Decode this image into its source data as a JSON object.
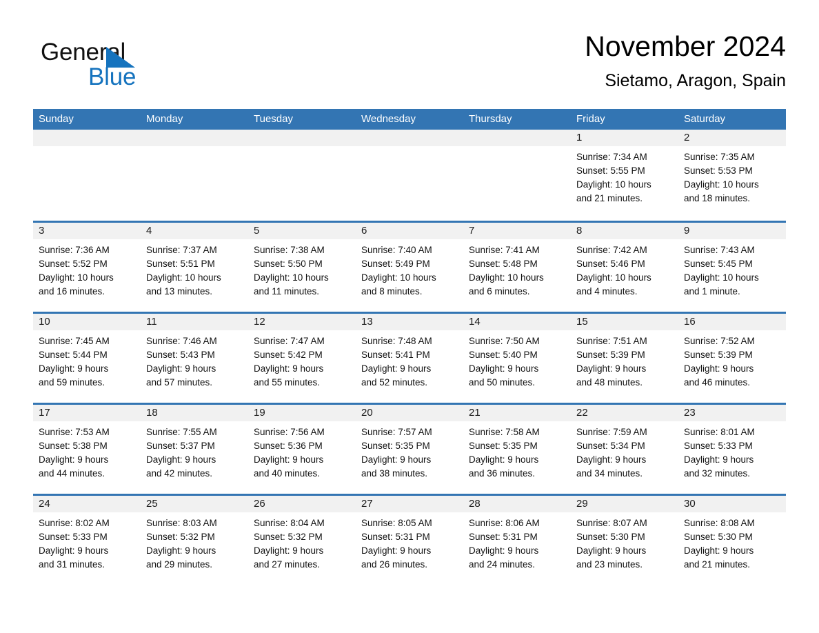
{
  "brand": {
    "name_part1": "General",
    "name_part2": "Blue",
    "accent_color": "#1573be"
  },
  "header": {
    "month_title": "November 2024",
    "location": "Sietamo, Aragon, Spain"
  },
  "calendar": {
    "header_color": "#3375b3",
    "weekdays": [
      "Sunday",
      "Monday",
      "Tuesday",
      "Wednesday",
      "Thursday",
      "Friday",
      "Saturday"
    ],
    "weeks": [
      [
        {
          "day": "",
          "sunrise": "",
          "sunset": "",
          "daylight_line1": "",
          "daylight_line2": ""
        },
        {
          "day": "",
          "sunrise": "",
          "sunset": "",
          "daylight_line1": "",
          "daylight_line2": ""
        },
        {
          "day": "",
          "sunrise": "",
          "sunset": "",
          "daylight_line1": "",
          "daylight_line2": ""
        },
        {
          "day": "",
          "sunrise": "",
          "sunset": "",
          "daylight_line1": "",
          "daylight_line2": ""
        },
        {
          "day": "",
          "sunrise": "",
          "sunset": "",
          "daylight_line1": "",
          "daylight_line2": ""
        },
        {
          "day": "1",
          "sunrise": "Sunrise: 7:34 AM",
          "sunset": "Sunset: 5:55 PM",
          "daylight_line1": "Daylight: 10 hours",
          "daylight_line2": "and 21 minutes."
        },
        {
          "day": "2",
          "sunrise": "Sunrise: 7:35 AM",
          "sunset": "Sunset: 5:53 PM",
          "daylight_line1": "Daylight: 10 hours",
          "daylight_line2": "and 18 minutes."
        }
      ],
      [
        {
          "day": "3",
          "sunrise": "Sunrise: 7:36 AM",
          "sunset": "Sunset: 5:52 PM",
          "daylight_line1": "Daylight: 10 hours",
          "daylight_line2": "and 16 minutes."
        },
        {
          "day": "4",
          "sunrise": "Sunrise: 7:37 AM",
          "sunset": "Sunset: 5:51 PM",
          "daylight_line1": "Daylight: 10 hours",
          "daylight_line2": "and 13 minutes."
        },
        {
          "day": "5",
          "sunrise": "Sunrise: 7:38 AM",
          "sunset": "Sunset: 5:50 PM",
          "daylight_line1": "Daylight: 10 hours",
          "daylight_line2": "and 11 minutes."
        },
        {
          "day": "6",
          "sunrise": "Sunrise: 7:40 AM",
          "sunset": "Sunset: 5:49 PM",
          "daylight_line1": "Daylight: 10 hours",
          "daylight_line2": "and 8 minutes."
        },
        {
          "day": "7",
          "sunrise": "Sunrise: 7:41 AM",
          "sunset": "Sunset: 5:48 PM",
          "daylight_line1": "Daylight: 10 hours",
          "daylight_line2": "and 6 minutes."
        },
        {
          "day": "8",
          "sunrise": "Sunrise: 7:42 AM",
          "sunset": "Sunset: 5:46 PM",
          "daylight_line1": "Daylight: 10 hours",
          "daylight_line2": "and 4 minutes."
        },
        {
          "day": "9",
          "sunrise": "Sunrise: 7:43 AM",
          "sunset": "Sunset: 5:45 PM",
          "daylight_line1": "Daylight: 10 hours",
          "daylight_line2": "and 1 minute."
        }
      ],
      [
        {
          "day": "10",
          "sunrise": "Sunrise: 7:45 AM",
          "sunset": "Sunset: 5:44 PM",
          "daylight_line1": "Daylight: 9 hours",
          "daylight_line2": "and 59 minutes."
        },
        {
          "day": "11",
          "sunrise": "Sunrise: 7:46 AM",
          "sunset": "Sunset: 5:43 PM",
          "daylight_line1": "Daylight: 9 hours",
          "daylight_line2": "and 57 minutes."
        },
        {
          "day": "12",
          "sunrise": "Sunrise: 7:47 AM",
          "sunset": "Sunset: 5:42 PM",
          "daylight_line1": "Daylight: 9 hours",
          "daylight_line2": "and 55 minutes."
        },
        {
          "day": "13",
          "sunrise": "Sunrise: 7:48 AM",
          "sunset": "Sunset: 5:41 PM",
          "daylight_line1": "Daylight: 9 hours",
          "daylight_line2": "and 52 minutes."
        },
        {
          "day": "14",
          "sunrise": "Sunrise: 7:50 AM",
          "sunset": "Sunset: 5:40 PM",
          "daylight_line1": "Daylight: 9 hours",
          "daylight_line2": "and 50 minutes."
        },
        {
          "day": "15",
          "sunrise": "Sunrise: 7:51 AM",
          "sunset": "Sunset: 5:39 PM",
          "daylight_line1": "Daylight: 9 hours",
          "daylight_line2": "and 48 minutes."
        },
        {
          "day": "16",
          "sunrise": "Sunrise: 7:52 AM",
          "sunset": "Sunset: 5:39 PM",
          "daylight_line1": "Daylight: 9 hours",
          "daylight_line2": "and 46 minutes."
        }
      ],
      [
        {
          "day": "17",
          "sunrise": "Sunrise: 7:53 AM",
          "sunset": "Sunset: 5:38 PM",
          "daylight_line1": "Daylight: 9 hours",
          "daylight_line2": "and 44 minutes."
        },
        {
          "day": "18",
          "sunrise": "Sunrise: 7:55 AM",
          "sunset": "Sunset: 5:37 PM",
          "daylight_line1": "Daylight: 9 hours",
          "daylight_line2": "and 42 minutes."
        },
        {
          "day": "19",
          "sunrise": "Sunrise: 7:56 AM",
          "sunset": "Sunset: 5:36 PM",
          "daylight_line1": "Daylight: 9 hours",
          "daylight_line2": "and 40 minutes."
        },
        {
          "day": "20",
          "sunrise": "Sunrise: 7:57 AM",
          "sunset": "Sunset: 5:35 PM",
          "daylight_line1": "Daylight: 9 hours",
          "daylight_line2": "and 38 minutes."
        },
        {
          "day": "21",
          "sunrise": "Sunrise: 7:58 AM",
          "sunset": "Sunset: 5:35 PM",
          "daylight_line1": "Daylight: 9 hours",
          "daylight_line2": "and 36 minutes."
        },
        {
          "day": "22",
          "sunrise": "Sunrise: 7:59 AM",
          "sunset": "Sunset: 5:34 PM",
          "daylight_line1": "Daylight: 9 hours",
          "daylight_line2": "and 34 minutes."
        },
        {
          "day": "23",
          "sunrise": "Sunrise: 8:01 AM",
          "sunset": "Sunset: 5:33 PM",
          "daylight_line1": "Daylight: 9 hours",
          "daylight_line2": "and 32 minutes."
        }
      ],
      [
        {
          "day": "24",
          "sunrise": "Sunrise: 8:02 AM",
          "sunset": "Sunset: 5:33 PM",
          "daylight_line1": "Daylight: 9 hours",
          "daylight_line2": "and 31 minutes."
        },
        {
          "day": "25",
          "sunrise": "Sunrise: 8:03 AM",
          "sunset": "Sunset: 5:32 PM",
          "daylight_line1": "Daylight: 9 hours",
          "daylight_line2": "and 29 minutes."
        },
        {
          "day": "26",
          "sunrise": "Sunrise: 8:04 AM",
          "sunset": "Sunset: 5:32 PM",
          "daylight_line1": "Daylight: 9 hours",
          "daylight_line2": "and 27 minutes."
        },
        {
          "day": "27",
          "sunrise": "Sunrise: 8:05 AM",
          "sunset": "Sunset: 5:31 PM",
          "daylight_line1": "Daylight: 9 hours",
          "daylight_line2": "and 26 minutes."
        },
        {
          "day": "28",
          "sunrise": "Sunrise: 8:06 AM",
          "sunset": "Sunset: 5:31 PM",
          "daylight_line1": "Daylight: 9 hours",
          "daylight_line2": "and 24 minutes."
        },
        {
          "day": "29",
          "sunrise": "Sunrise: 8:07 AM",
          "sunset": "Sunset: 5:30 PM",
          "daylight_line1": "Daylight: 9 hours",
          "daylight_line2": "and 23 minutes."
        },
        {
          "day": "30",
          "sunrise": "Sunrise: 8:08 AM",
          "sunset": "Sunset: 5:30 PM",
          "daylight_line1": "Daylight: 9 hours",
          "daylight_line2": "and 21 minutes."
        }
      ]
    ]
  }
}
